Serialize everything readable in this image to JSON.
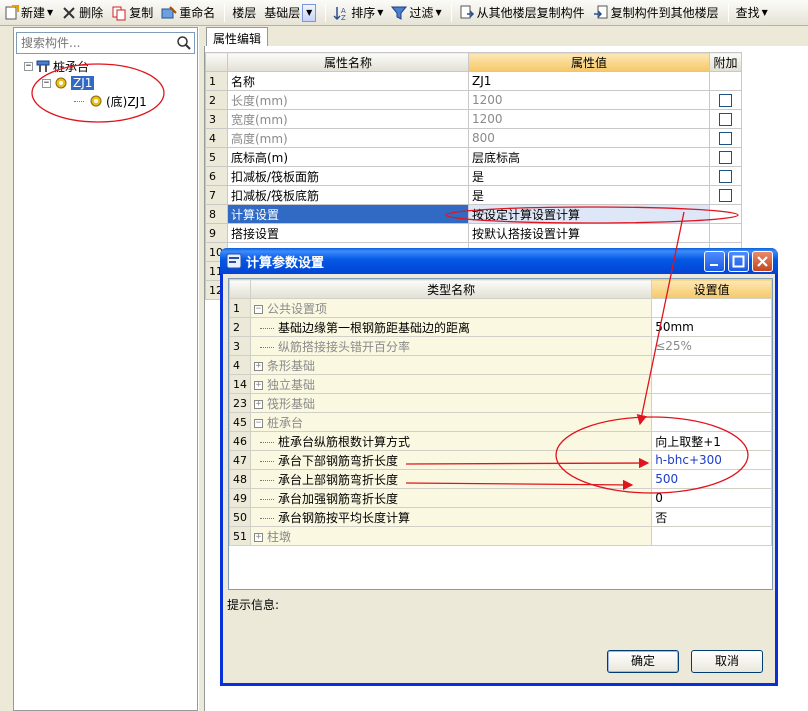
{
  "toolbar": {
    "items": [
      {
        "label": "新建",
        "icon": "new-icon",
        "has_arrow": true
      },
      {
        "label": "删除",
        "icon": "delete-icon",
        "has_arrow": false
      },
      {
        "label": "复制",
        "icon": "copy-icon",
        "has_arrow": false
      },
      {
        "label": "重命名",
        "icon": "rename-icon",
        "has_arrow": false
      },
      {
        "label": "楼层",
        "icon": "",
        "has_arrow": false
      },
      {
        "label": "基础层",
        "icon": "",
        "has_arrow": false
      },
      {
        "label": "排序",
        "icon": "sort-icon",
        "has_arrow": true
      },
      {
        "label": "过滤",
        "icon": "filter-icon",
        "has_arrow": true
      },
      {
        "label": "从其他楼层复制构件",
        "icon": "copy-from-floor-icon",
        "has_arrow": false
      },
      {
        "label": "复制构件到其他楼层",
        "icon": "copy-to-floor-icon",
        "has_arrow": false
      },
      {
        "label": "查找",
        "icon": "",
        "has_arrow": true
      }
    ]
  },
  "left_panel": {
    "search_placeholder": "搜索构件...",
    "tree": {
      "root": "桩承台",
      "child": "ZJ1",
      "grandchild": "(底)ZJ1"
    }
  },
  "property_panel": {
    "tab": "属性编辑",
    "columns": [
      "属性名称",
      "属性值",
      "附加"
    ],
    "rows": [
      {
        "no": "1",
        "name": "名称",
        "value": "ZJ1",
        "gray": false,
        "check": false
      },
      {
        "no": "2",
        "name": "长度(mm)",
        "value": "1200",
        "gray": true,
        "check": true
      },
      {
        "no": "3",
        "name": "宽度(mm)",
        "value": "1200",
        "gray": true,
        "check": true
      },
      {
        "no": "4",
        "name": "高度(mm)",
        "value": "800",
        "gray": true,
        "check": true
      },
      {
        "no": "5",
        "name": "底标高(m)",
        "value": "层底标高",
        "gray": false,
        "check": true
      },
      {
        "no": "6",
        "name": "扣减板/筏板面筋",
        "value": "是",
        "gray": false,
        "check": true
      },
      {
        "no": "7",
        "name": "扣减板/筏板底筋",
        "value": "是",
        "gray": false,
        "check": true
      },
      {
        "no": "8",
        "name": "计算设置",
        "value": "按设定计算设置计算",
        "gray": false,
        "check": false,
        "selected": true
      },
      {
        "no": "9",
        "name": "搭接设置",
        "value": "按默认搭接设置计算",
        "gray": false,
        "check": false
      },
      {
        "no": "10",
        "name": "",
        "value": "",
        "gray": false,
        "check": false
      },
      {
        "no": "11",
        "name": "",
        "value": "",
        "gray": false,
        "check": false
      },
      {
        "no": "12",
        "name": "",
        "value": "",
        "gray": false,
        "check": false
      }
    ]
  },
  "dialog": {
    "title": "计算参数设置",
    "columns": [
      "类型名称",
      "设置值"
    ],
    "rows": [
      {
        "no": "1",
        "name": "公共设置项",
        "value": "",
        "kind": "group-open"
      },
      {
        "no": "2",
        "name": "基础边缘第一根钢筋距基础边的距离",
        "value": "50mm",
        "kind": "item"
      },
      {
        "no": "3",
        "name": "纵筋搭接接头错开百分率",
        "value": "≤25%",
        "kind": "item-disabled"
      },
      {
        "no": "4",
        "name": "条形基础",
        "value": "",
        "kind": "group-closed"
      },
      {
        "no": "14",
        "name": "独立基础",
        "value": "",
        "kind": "group-closed"
      },
      {
        "no": "23",
        "name": "筏形基础",
        "value": "",
        "kind": "group-closed"
      },
      {
        "no": "45",
        "name": "桩承台",
        "value": "",
        "kind": "group-open"
      },
      {
        "no": "46",
        "name": "桩承台纵筋根数计算方式",
        "value": "向上取整+1",
        "kind": "item"
      },
      {
        "no": "47",
        "name": "承台下部钢筋弯折长度",
        "value": "h-bhc+300",
        "kind": "item-blue"
      },
      {
        "no": "48",
        "name": "承台上部钢筋弯折长度",
        "value": "500",
        "kind": "item-blue"
      },
      {
        "no": "49",
        "name": "承台加强钢筋弯折长度",
        "value": "0",
        "kind": "item"
      },
      {
        "no": "50",
        "name": "承台钢筋按平均长度计算",
        "value": "否",
        "kind": "item"
      },
      {
        "no": "51",
        "name": "柱墩",
        "value": "",
        "kind": "group-closed"
      }
    ],
    "hint_label": "提示信息:",
    "ok_label": "确定",
    "cancel_label": "取消"
  },
  "colors": {
    "selection": "#316ac5",
    "header_highlight": "#f5c867",
    "annotation_red": "#e0141e",
    "title_blue": "#0458e4"
  }
}
